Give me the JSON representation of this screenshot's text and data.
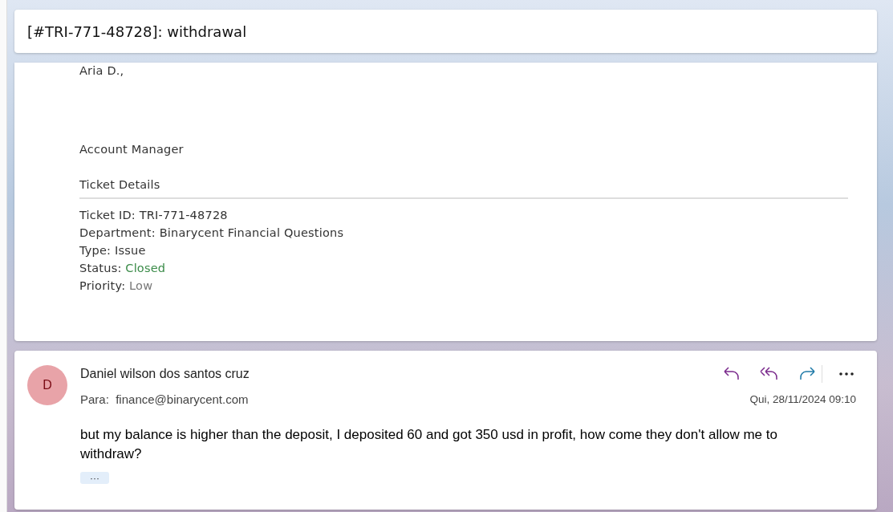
{
  "subject": "[#TRI-771-48728]: withdrawal",
  "ticket": {
    "signature": [
      "Aria D.,",
      "Account Manager"
    ],
    "details_heading": "Ticket Details",
    "details": [
      {
        "label": "Ticket ID:",
        "value": "TRI-771-48728",
        "color": "#333333"
      },
      {
        "label": "Department:",
        "value": "Binarycent Financial Questions",
        "color": "#333333"
      },
      {
        "label": "Type:",
        "value": "Issue",
        "color": "#333333"
      },
      {
        "label": "Status:",
        "value": "Closed",
        "color": "#3c8c4a"
      },
      {
        "label": "Priority:",
        "value": "Low",
        "color": "#777777"
      }
    ]
  },
  "message": {
    "avatar": "D",
    "sender": "Daniel wilson dos santos cruz",
    "to_label": "Para:",
    "to": "finance@binarycent.com",
    "date": "Qui, 28/11/2024 09:10",
    "body": "but my balance is higher than the deposit, I deposited 60 and got 350 usd in profit, how come they don't allow me to withdraw?",
    "actions": [
      {
        "kind": "reply"
      },
      {
        "kind": "reply-all"
      },
      {
        "kind": "forward"
      },
      {
        "kind": "more"
      }
    ],
    "expand": "···"
  }
}
